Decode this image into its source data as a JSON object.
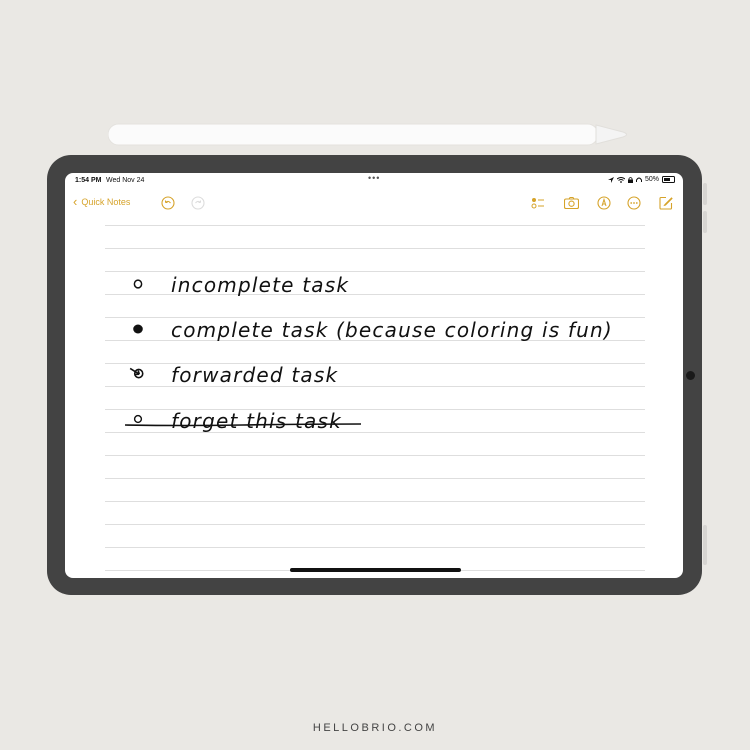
{
  "status_bar": {
    "time": "1:54 PM",
    "date": "Wed Nov 24",
    "battery": "50%",
    "battery_level": 0.5
  },
  "toolbar": {
    "back_label": "Quick Notes",
    "icons": [
      "undo-icon",
      "redo-icon",
      "checklist-icon",
      "camera-icon",
      "markup-icon",
      "more-icon",
      "compose-icon"
    ],
    "accent": "#d6a32a"
  },
  "note": {
    "tasks": [
      {
        "mark": "open-circle",
        "text": "incomplete task",
        "struck": false
      },
      {
        "mark": "filled-dot",
        "text": "complete task (because coloring is fun)",
        "struck": false
      },
      {
        "mark": "forward-arrow",
        "text": "forwarded task",
        "struck": false
      },
      {
        "mark": "struck-circle",
        "text": "forget this task",
        "struck": true
      }
    ]
  },
  "footer": {
    "brand": "HELLOBRIO.COM"
  }
}
